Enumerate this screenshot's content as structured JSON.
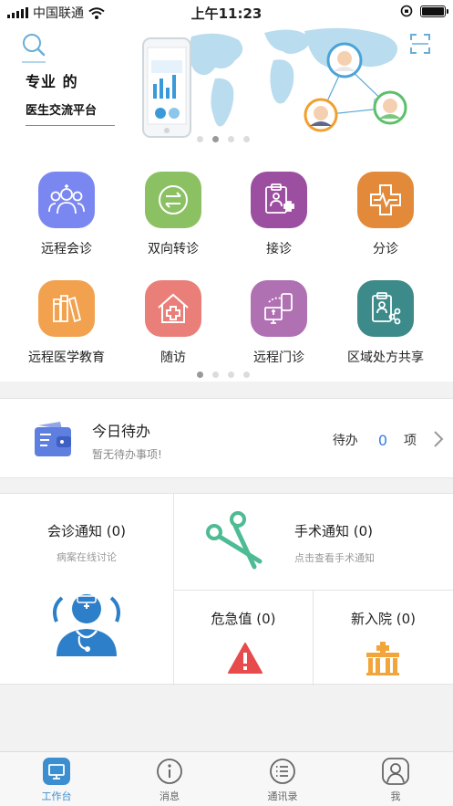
{
  "status_bar": {
    "carrier": "中国联通",
    "time": "上午11:23"
  },
  "banner": {
    "tagline_top": "专业 的",
    "tagline_bottom": "医生交流平台",
    "page_dots": 4,
    "active_dot": 1
  },
  "services": {
    "items": [
      {
        "label": "远程会诊",
        "icon": "doctors-group-icon",
        "color": "#7b87f0"
      },
      {
        "label": "双向转诊",
        "icon": "transfer-arrows-icon",
        "color": "#8cc163"
      },
      {
        "label": "接诊",
        "icon": "clipboard-plus-icon",
        "color": "#9c4fa0"
      },
      {
        "label": "分诊",
        "icon": "triage-cross-icon",
        "color": "#e38a3a"
      },
      {
        "label": "远程医学教育",
        "icon": "books-icon",
        "color": "#f2a14e"
      },
      {
        "label": "随访",
        "icon": "house-cross-icon",
        "color": "#ea7f7a"
      },
      {
        "label": "远程门诊",
        "icon": "phone-monitor-icon",
        "color": "#b071b3"
      },
      {
        "label": "区域处方共享",
        "icon": "prescription-share-icon",
        "color": "#3d8a8a"
      }
    ],
    "page_dots": 4,
    "active_dot": 0
  },
  "todo": {
    "title": "今日待办",
    "subtitle": "暂无待办事项!",
    "prefix": "待办",
    "count": "0",
    "unit": "项"
  },
  "cards": {
    "consult": {
      "title": "会诊通知 (0)",
      "subtitle": "病案在线讨论"
    },
    "surgery": {
      "title": "手术通知 (0)",
      "subtitle": "点击查看手术通知"
    },
    "critical": {
      "title": "危急值 (0)"
    },
    "admission": {
      "title": "新入院 (0)"
    }
  },
  "tabbar": {
    "items": [
      {
        "label": "工作台",
        "icon": "workbench-icon"
      },
      {
        "label": "消息",
        "icon": "info-icon"
      },
      {
        "label": "通讯录",
        "icon": "contacts-list-icon"
      },
      {
        "label": "我",
        "icon": "profile-icon"
      }
    ],
    "active": 0
  },
  "colors": {
    "accent": "#3b8fd1",
    "todo_count": "#3a7be0",
    "surgery_icon": "#4dbb94",
    "critical_icon": "#e84b4b",
    "admission_icon": "#f2a53a",
    "consult_icon": "#2c7fc8"
  }
}
